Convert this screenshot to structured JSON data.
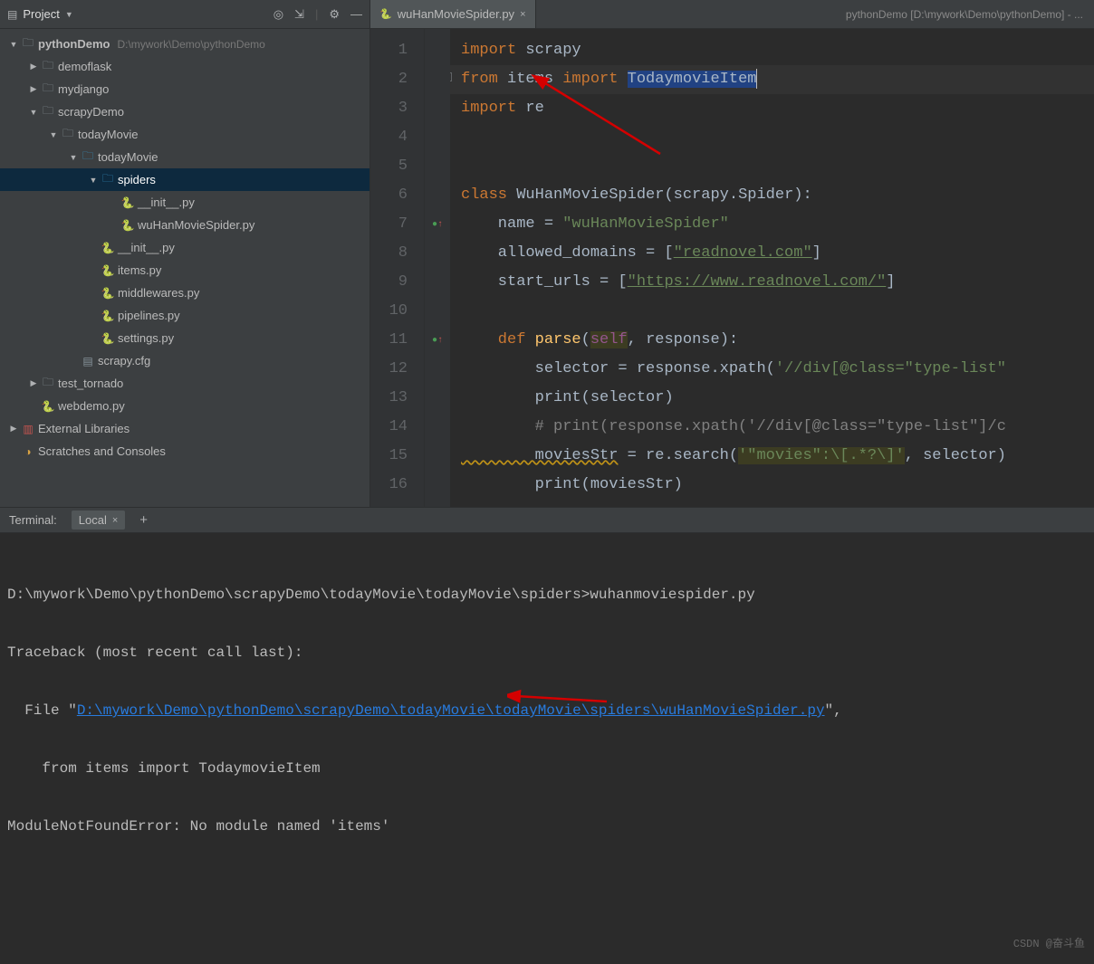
{
  "sidebar": {
    "title": "Project",
    "icons": {
      "target": "◎",
      "collapse": "⇲",
      "gear": "⚙",
      "minimize": "—"
    },
    "tree": [
      {
        "depth": 0,
        "expand": "▼",
        "iconType": "folder-closed",
        "label": "pythonDemo",
        "path": "D:\\mywork\\Demo\\pythonDemo",
        "bold": true
      },
      {
        "depth": 1,
        "expand": "▶",
        "iconType": "folder-closed",
        "label": "demoflask"
      },
      {
        "depth": 1,
        "expand": "▶",
        "iconType": "folder-closed",
        "label": "mydjango"
      },
      {
        "depth": 1,
        "expand": "▼",
        "iconType": "folder-closed",
        "label": "scrapyDemo"
      },
      {
        "depth": 2,
        "expand": "▼",
        "iconType": "folder-closed",
        "label": "todayMovie"
      },
      {
        "depth": 3,
        "expand": "▼",
        "iconType": "folder-blue",
        "label": "todayMovie"
      },
      {
        "depth": 4,
        "expand": "▼",
        "iconType": "folder-blue",
        "label": "spiders",
        "selected": true
      },
      {
        "depth": 5,
        "expand": "",
        "iconType": "py",
        "label": "__init__.py"
      },
      {
        "depth": 5,
        "expand": "",
        "iconType": "py",
        "label": "wuHanMovieSpider.py"
      },
      {
        "depth": 4,
        "expand": "",
        "iconType": "py",
        "label": "__init__.py"
      },
      {
        "depth": 4,
        "expand": "",
        "iconType": "py",
        "label": "items.py"
      },
      {
        "depth": 4,
        "expand": "",
        "iconType": "py",
        "label": "middlewares.py"
      },
      {
        "depth": 4,
        "expand": "",
        "iconType": "py",
        "label": "pipelines.py"
      },
      {
        "depth": 4,
        "expand": "",
        "iconType": "py",
        "label": "settings.py"
      },
      {
        "depth": 3,
        "expand": "",
        "iconType": "file",
        "label": "scrapy.cfg"
      },
      {
        "depth": 1,
        "expand": "▶",
        "iconType": "folder-closed",
        "label": "test_tornado"
      },
      {
        "depth": 1,
        "expand": "",
        "iconType": "py",
        "label": "webdemo.py"
      },
      {
        "depth": 0,
        "expand": "▶",
        "iconType": "lib",
        "label": "External Libraries"
      },
      {
        "depth": 0,
        "expand": "",
        "iconType": "scratch",
        "label": "Scratches and Consoles"
      }
    ]
  },
  "editor": {
    "tab": {
      "name": "wuHanMovieSpider.py",
      "close": "×"
    },
    "titleBar": "pythonDemo [D:\\mywork\\Demo\\pythonDemo] - ...",
    "lineNumbers": [
      "1",
      "2",
      "3",
      "4",
      "5",
      "6",
      "7",
      "8",
      "9",
      "10",
      "11",
      "12",
      "13",
      "14",
      "15",
      "16"
    ]
  },
  "code": {
    "l1_import": "import",
    "l1_scrapy": " scrapy",
    "l2_from": "from",
    "l2_items": " items ",
    "l2_import": "import",
    "l2_sp": " ",
    "l2_class": "TodaymovieItem",
    "l3_import": "import",
    "l3_re": " re",
    "l6_class": "class ",
    "l6_name": "WuHanMovieSpider",
    "l6_paren": "(scrapy.Spider):",
    "l7_name": "    name = ",
    "l7_str": "\"wuHanMovieSpider\"",
    "l8_allowed": "    allowed_domains = [",
    "l8_str": "\"readnovel.com\"",
    "l8_end": "]",
    "l9_start": "    start_urls = [",
    "l9_str": "\"https://www.readnovel.com/\"",
    "l9_end": "]",
    "l11_def": "    def ",
    "l11_fn": "parse",
    "l11_p1": "(",
    "l11_self": "self",
    "l11_comma": ", ",
    "l11_resp": "response",
    "l11_p2": "):",
    "l12": "        selector = response.xpath(",
    "l12_str": "'//div[@class=\"type-list\"",
    "l13_print": "        print",
    "l13_arg": "(selector)",
    "l14": "        # print(response.xpath('//div[@class=\"type-list\"]/c",
    "l15": "        moviesStr",
    "l15_eq": " = re.search(",
    "l15_str": "'\"movies\":\\[.*?\\]'",
    "l15_end": ", selector)",
    "l16_print": "        print",
    "l16_arg": "(moviesStr)"
  },
  "terminal": {
    "label": "Terminal:",
    "tabLocal": "Local",
    "plus": "+",
    "line1": "D:\\mywork\\Demo\\pythonDemo\\scrapyDemo\\todayMovie\\todayMovie\\spiders>wuhanmoviespider.py",
    "line2": "Traceback (most recent call last):",
    "line3a": "  File \"",
    "line3link": "D:\\mywork\\Demo\\pythonDemo\\scrapyDemo\\todayMovie\\todayMovie\\spiders\\wuHanMovieSpider.py",
    "line3b": "\",",
    "line4": "    from items import TodaymovieItem",
    "line5": "ModuleNotFoundError: No module named 'items'"
  },
  "watermark": "CSDN @奋斗鱼"
}
